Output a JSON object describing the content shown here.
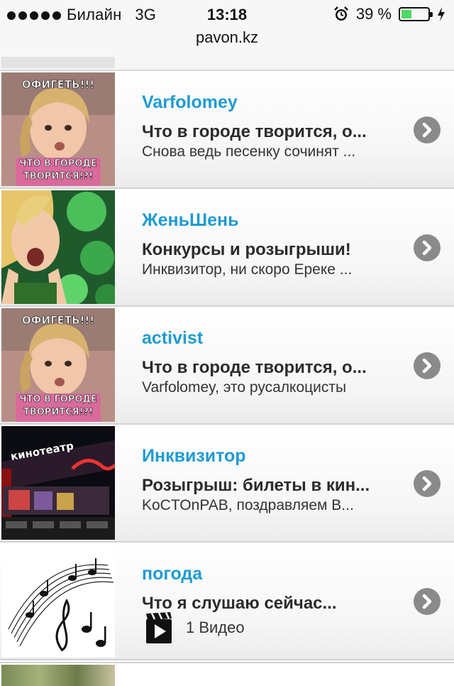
{
  "status_bar": {
    "carrier": "Билайн",
    "network": "3G",
    "time": "13:18",
    "battery_text": "39 %",
    "battery_level": 0.39,
    "battery_color": "#4cd964"
  },
  "url_bar": {
    "domain": "pavon.kz"
  },
  "accent_color": "#1f9bd1",
  "items": [
    {
      "author": "Varfolomey",
      "title": "Что в городе творится, о...",
      "subtitle": "Снова ведь песенку сочинят ...",
      "thumb": "meme-girl-image"
    },
    {
      "author": "ЖеньШень",
      "title": "Конкурсы и розыгрыши!",
      "subtitle": "Инквизитор, ни скоро Ереке ...",
      "thumb": "excited-woman-image"
    },
    {
      "author": "activist",
      "title": "Что в городе творится, о...",
      "subtitle": "Varfolomey, это русалкоцисты",
      "thumb": "meme-girl-image"
    },
    {
      "author": "Инквизитор",
      "title": "Розыгрыш: билеты в кин...",
      "subtitle": "KoCTOnPAB, поздравляем В...",
      "thumb": "cinema-image"
    },
    {
      "author": "погода",
      "title": "Что я слушаю сейчас...",
      "video_label": "1 Видео",
      "thumb": "music-notes-image"
    }
  ],
  "thumb_text": {
    "meme_top": "ОФИГЕТЬ!!!",
    "meme_bottom_1": "ЧТО В ГОРОДЕ",
    "meme_bottom_2": "ТВОРИТСЯ!?!",
    "cinema_sign": "кинотеатр"
  }
}
